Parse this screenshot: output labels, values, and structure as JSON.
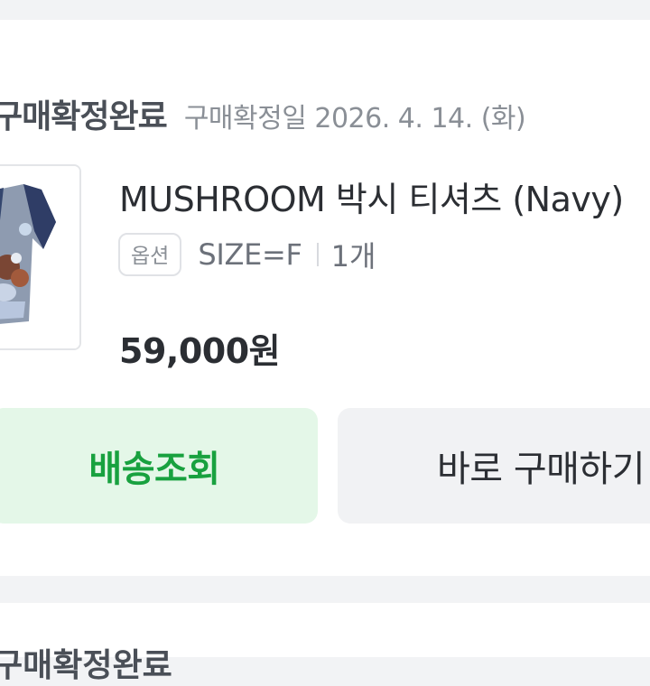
{
  "order": {
    "status": "구매확정완료",
    "confirm_date": "구매확정일 2026. 4. 14. (화)",
    "product": {
      "name": "MUSHROOM 박시 티셔츠 (Navy)",
      "option_badge": "옵션",
      "option_value": "SIZE=F",
      "quantity": "1개",
      "price": "59,000원"
    },
    "buttons": {
      "track": "배송조회",
      "buy_again": "바로 구매하기"
    }
  },
  "next_order": {
    "status": "구매확정완료"
  },
  "colors": {
    "track_button_bg": "#e4f7e8",
    "track_button_text": "#18a13f",
    "secondary_button_bg": "#f1f2f4"
  }
}
